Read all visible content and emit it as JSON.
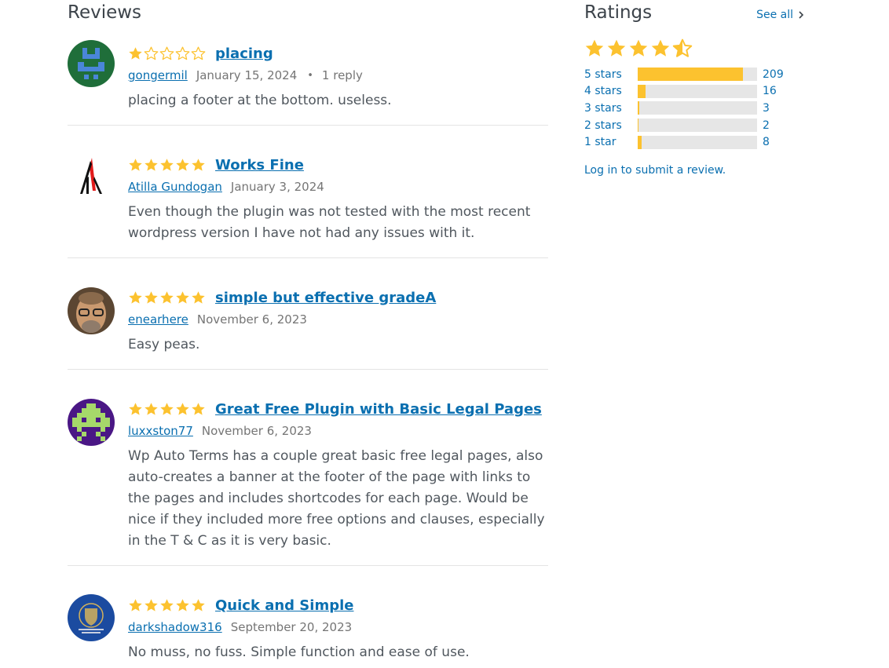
{
  "reviews_section": {
    "title": "Reviews",
    "reviews": [
      {
        "rating": 1,
        "title": "placing",
        "author": "gongermil",
        "date": "January 15, 2024",
        "separator": "•",
        "replies": "1 reply",
        "text": "placing a footer at the bottom. useless."
      },
      {
        "rating": 5,
        "title": "Works Fine",
        "author": "Atilla Gundogan",
        "date": "January 3, 2024",
        "text": "Even though the plugin was not tested with the most recent wordpress version I have not had any issues with it."
      },
      {
        "rating": 5,
        "title": "simple but effective gradeA",
        "author": "enearhere",
        "date": "November 6, 2023",
        "text": "Easy peas."
      },
      {
        "rating": 5,
        "title": "Great Free Plugin with Basic Legal Pages",
        "author": "luxxston77",
        "date": "November 6, 2023",
        "text": "Wp Auto Terms has a couple great basic free legal pages, also auto-creates a banner at the footer of the page with links to the pages and includes shortcodes for each page. Would be nice if they included more free options and clauses, especially in the T & C as it is very basic."
      },
      {
        "rating": 5,
        "title": "Quick and Simple",
        "author": "darkshadow316",
        "date": "September 20, 2023",
        "text": "No muss, no fuss. Simple function and ease of use."
      }
    ]
  },
  "ratings_section": {
    "title": "Ratings",
    "see_all": "See all",
    "average_rating": 4.5,
    "distribution": [
      {
        "label": "5 stars",
        "count": "209",
        "fraction": 0.88
      },
      {
        "label": "4 stars",
        "count": "16",
        "fraction": 0.067
      },
      {
        "label": "3 stars",
        "count": "3",
        "fraction": 0.013
      },
      {
        "label": "2 stars",
        "count": "2",
        "fraction": 0.009
      },
      {
        "label": "1 star",
        "count": "8",
        "fraction": 0.034
      }
    ],
    "login_link": "Log in to submit a review."
  },
  "colors": {
    "star": "#fcc22f",
    "link": "#0a6fb0",
    "bar_bg": "#e6e6e6"
  }
}
